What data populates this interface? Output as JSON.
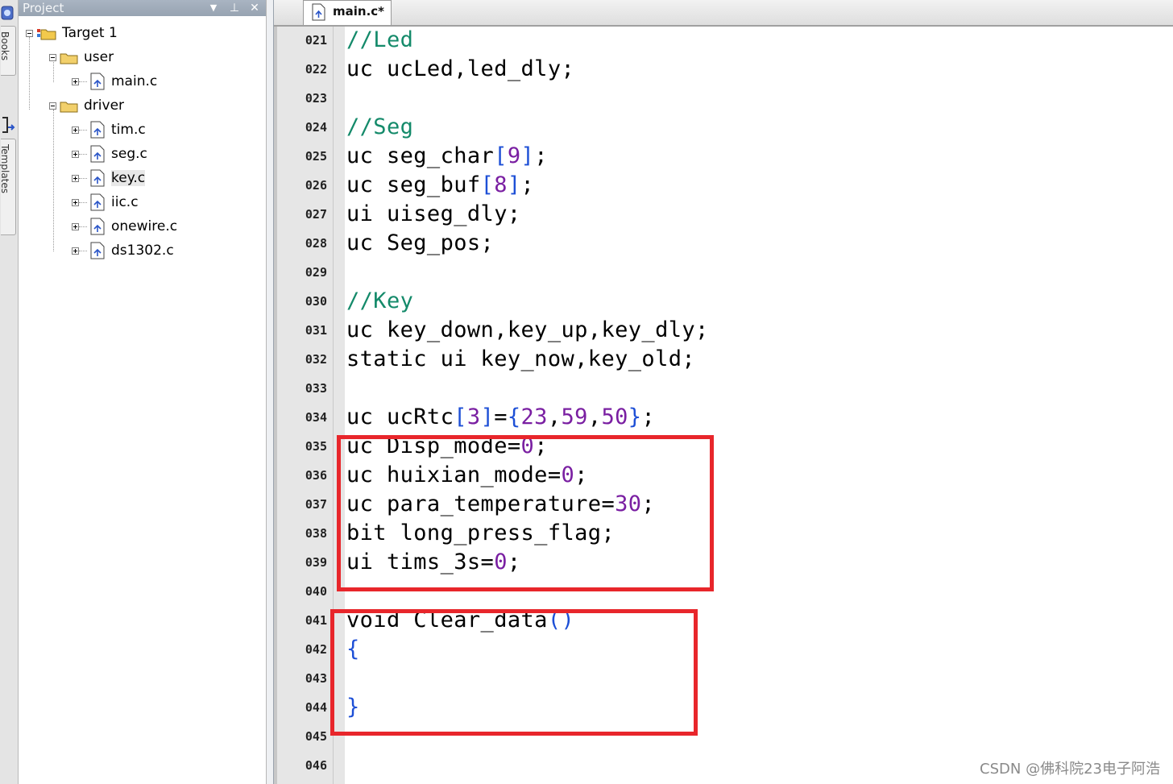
{
  "side_strip": {
    "tabs": [
      {
        "label": "Books"
      },
      {
        "label": "Templates"
      }
    ]
  },
  "project_panel": {
    "title": "Project",
    "dropdown_glyph": "▼",
    "pin_glyph": "⊥",
    "close_glyph": "✕"
  },
  "tree": {
    "target": "Target 1",
    "groups": [
      {
        "label": "user",
        "files": [
          "main.c"
        ]
      },
      {
        "label": "driver",
        "files": [
          "tim.c",
          "seg.c",
          "key.c",
          "iic.c",
          "onewire.c",
          "ds1302.c"
        ]
      }
    ],
    "selected_file": "key.c"
  },
  "editor": {
    "tab_label": "main.c*",
    "line_numbers": [
      "021",
      "022",
      "023",
      "024",
      "025",
      "026",
      "027",
      "028",
      "029",
      "030",
      "031",
      "032",
      "033",
      "034",
      "035",
      "036",
      "037",
      "038",
      "039",
      "040",
      "041",
      "042",
      "043",
      "044",
      "045",
      "046"
    ],
    "lines": [
      [
        {
          "t": "//Led",
          "c": "cm"
        }
      ],
      [
        {
          "t": "uc ucLed,led_dly;"
        }
      ],
      [],
      [
        {
          "t": "//Seg",
          "c": "cm"
        }
      ],
      [
        {
          "t": "uc seg_char"
        },
        {
          "t": "[",
          "c": "br"
        },
        {
          "t": "9",
          "c": "num"
        },
        {
          "t": "]",
          "c": "br"
        },
        {
          "t": ";"
        }
      ],
      [
        {
          "t": "uc seg_buf"
        },
        {
          "t": "[",
          "c": "br"
        },
        {
          "t": "8",
          "c": "num"
        },
        {
          "t": "]",
          "c": "br"
        },
        {
          "t": ";"
        }
      ],
      [
        {
          "t": "ui uiseg_dly;"
        }
      ],
      [
        {
          "t": "uc Seg_pos;"
        }
      ],
      [],
      [
        {
          "t": "//Key",
          "c": "cm"
        }
      ],
      [
        {
          "t": "uc key_down,key_up,key_dly;"
        }
      ],
      [
        {
          "t": "static ui key_now,key_old;"
        }
      ],
      [],
      [
        {
          "t": "uc ucRtc"
        },
        {
          "t": "[",
          "c": "br"
        },
        {
          "t": "3",
          "c": "num"
        },
        {
          "t": "]",
          "c": "br"
        },
        {
          "t": "="
        },
        {
          "t": "{",
          "c": "br"
        },
        {
          "t": "23",
          "c": "num"
        },
        {
          "t": ","
        },
        {
          "t": "59",
          "c": "num"
        },
        {
          "t": ","
        },
        {
          "t": "50",
          "c": "num"
        },
        {
          "t": "}",
          "c": "br"
        },
        {
          "t": ";"
        }
      ],
      [
        {
          "t": "uc Disp_mode="
        },
        {
          "t": "0",
          "c": "num"
        },
        {
          "t": ";"
        }
      ],
      [
        {
          "t": "uc huixian_mode="
        },
        {
          "t": "0",
          "c": "num"
        },
        {
          "t": ";"
        }
      ],
      [
        {
          "t": "uc para_temperature="
        },
        {
          "t": "30",
          "c": "num"
        },
        {
          "t": ";"
        }
      ],
      [
        {
          "t": "bit long_press_flag;"
        }
      ],
      [
        {
          "t": "ui tims_3s="
        },
        {
          "t": "0",
          "c": "num"
        },
        {
          "t": ";"
        }
      ],
      [],
      [
        {
          "t": "void Clear_data"
        },
        {
          "t": "()",
          "c": "br"
        }
      ],
      [
        {
          "t": "{",
          "c": "br"
        }
      ],
      [],
      [
        {
          "t": "}",
          "c": "br"
        }
      ],
      [],
      []
    ]
  },
  "watermark": "CSDN @佛科院23电子阿浩",
  "colors": {
    "highlight": "#e8262b",
    "comment": "#148a6a",
    "number": "#7a1fa2",
    "bracket": "#1d4fd6"
  }
}
